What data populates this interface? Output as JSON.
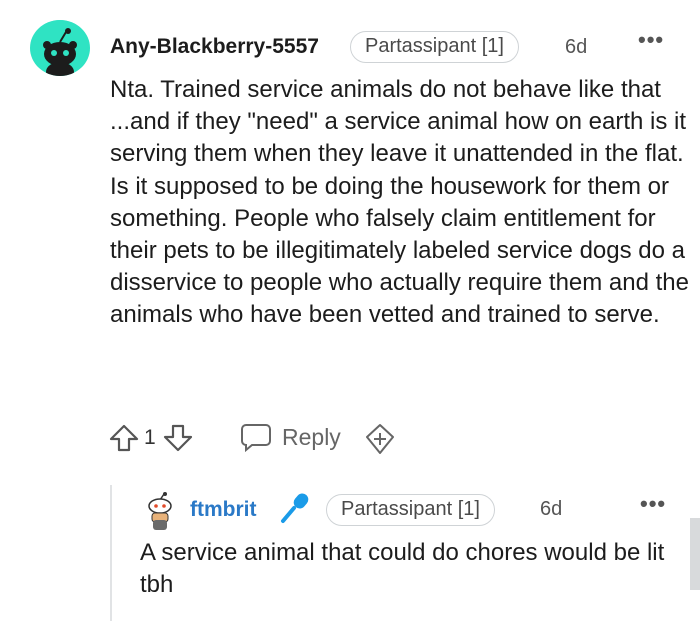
{
  "comment": {
    "username": "Any-Blackberry-5557",
    "flair": "Partassipant [1]",
    "age": "6d",
    "more": "•••",
    "body": "Nta. Trained service animals do not behave like that ...and if they \"need\" a service animal how on earth is it serving them when they leave it unattended in the flat. Is it supposed to be doing the housework for them or something. People who falsely claim entitlement for their pets to be illegitimately labeled service dogs do a disservice to people who actually require them and the animals who have been vetted and trained to serve.",
    "vote_count": "1",
    "reply_label": "Reply"
  },
  "reply": {
    "username": "ftmbrit",
    "flair": "Partassipant [1]",
    "age": "6d",
    "more": "•••",
    "body": "A service animal that could do chores would be lit tbh"
  },
  "colors": {
    "avatar_main": "#2fe3c3",
    "username_reply": "#2a79c7",
    "mic": "#1a9be8"
  },
  "icons": [
    "snoo-avatar-icon",
    "upvote-icon",
    "downvote-icon",
    "reply-icon",
    "award-icon",
    "snoo-avatar-small-icon",
    "microphone-icon",
    "more-options-icon"
  ]
}
